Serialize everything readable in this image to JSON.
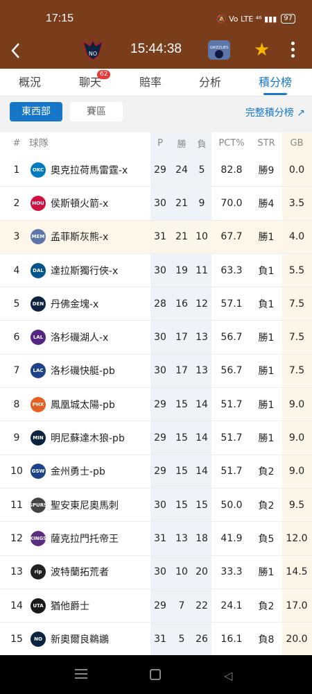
{
  "status_bar": {
    "time": "17:15",
    "icons": "🔕 Vo LTE ⁴⁶ ▮▮▮",
    "battery": "97"
  },
  "match": {
    "home_logo_text": "NO",
    "clock": "15:44:38",
    "away_logo_text": "GRIZZLIES",
    "home_color": "#0c2340",
    "away_color": "#5d76a9",
    "accent": "#f7b500"
  },
  "tabs": [
    {
      "label": "概況"
    },
    {
      "label": "聊天",
      "badge": "62"
    },
    {
      "label": "賠率"
    },
    {
      "label": "分析"
    },
    {
      "label": "積分榜"
    }
  ],
  "filter": {
    "segment_active": "東西部",
    "segment_inactive": "賽區",
    "full_standings": "完整積分榜 ↗"
  },
  "table": {
    "headers": {
      "rank": "#",
      "team": "球隊",
      "p": "P",
      "w": "勝",
      "l": "負",
      "pct": "PCT%",
      "str": "STR",
      "gb": "GB"
    },
    "rows": [
      {
        "rank": "1",
        "logo": "OKC",
        "color": "#007ac1",
        "team": "奧克拉荷馬雷霆-x",
        "p": "29",
        "w": "24",
        "l": "5",
        "pct": "82.8",
        "str": "勝9",
        "gb": "0.0"
      },
      {
        "rank": "2",
        "logo": "HOU",
        "color": "#ce1141",
        "team": "侯斯頓火箭-x",
        "p": "30",
        "w": "21",
        "l": "9",
        "pct": "70.0",
        "str": "勝4",
        "gb": "3.5"
      },
      {
        "rank": "3",
        "logo": "MEM",
        "color": "#5d76a9",
        "team": "孟菲斯灰熊-x",
        "p": "31",
        "w": "21",
        "l": "10",
        "pct": "67.7",
        "str": "勝1",
        "gb": "4.0",
        "highlight": true
      },
      {
        "rank": "4",
        "logo": "DAL",
        "color": "#00538c",
        "team": "達拉斯獨行俠-x",
        "p": "30",
        "w": "19",
        "l": "11",
        "pct": "63.3",
        "str": "負1",
        "gb": "5.5"
      },
      {
        "rank": "5",
        "logo": "DEN",
        "color": "#0e2240",
        "team": "丹佛金塊-x",
        "p": "28",
        "w": "16",
        "l": "12",
        "pct": "57.1",
        "str": "負1",
        "gb": "7.5"
      },
      {
        "rank": "6",
        "logo": "LAL",
        "color": "#552583",
        "team": "洛杉磯湖人-x",
        "p": "30",
        "w": "17",
        "l": "13",
        "pct": "56.7",
        "str": "勝1",
        "gb": "7.5"
      },
      {
        "rank": "7",
        "logo": "LAC",
        "color": "#1d428a",
        "team": "洛杉磯快艇-pb",
        "p": "30",
        "w": "17",
        "l": "13",
        "pct": "56.7",
        "str": "勝1",
        "gb": "7.5"
      },
      {
        "rank": "8",
        "logo": "PHX",
        "color": "#e56020",
        "team": "鳳凰城太陽-pb",
        "p": "29",
        "w": "15",
        "l": "14",
        "pct": "51.7",
        "str": "勝1",
        "gb": "9.0"
      },
      {
        "rank": "9",
        "logo": "MIN",
        "color": "#0c2340",
        "team": "明尼蘇達木狼-pb",
        "p": "29",
        "w": "15",
        "l": "14",
        "pct": "51.7",
        "str": "勝1",
        "gb": "9.0"
      },
      {
        "rank": "10",
        "logo": "GSW",
        "color": "#1d428a",
        "team": "金州勇士-pb",
        "p": "29",
        "w": "15",
        "l": "14",
        "pct": "51.7",
        "str": "負2",
        "gb": "9.0"
      },
      {
        "rank": "11",
        "logo": "SPURS",
        "color": "#444444",
        "team": "聖安東尼奧馬刺",
        "p": "30",
        "w": "15",
        "l": "15",
        "pct": "50.0",
        "str": "負2",
        "gb": "9.5"
      },
      {
        "rank": "12",
        "logo": "KINGS",
        "color": "#5a2d81",
        "team": "薩克拉門托帝王",
        "p": "31",
        "w": "13",
        "l": "18",
        "pct": "41.9",
        "str": "負5",
        "gb": "12.0"
      },
      {
        "rank": "13",
        "logo": "rip",
        "color": "#222222",
        "team": "波特蘭拓荒者",
        "p": "30",
        "w": "10",
        "l": "20",
        "pct": "33.3",
        "str": "勝1",
        "gb": "14.5"
      },
      {
        "rank": "14",
        "logo": "UTA",
        "color": "#1a1a1a",
        "team": "猶他爵士",
        "p": "29",
        "w": "7",
        "l": "22",
        "pct": "24.1",
        "str": "負2",
        "gb": "17.0"
      },
      {
        "rank": "15",
        "logo": "NO",
        "color": "#0c2340",
        "team": "新奧爾良鵜鶘",
        "p": "31",
        "w": "5",
        "l": "26",
        "pct": "16.1",
        "str": "負8",
        "gb": "20.0"
      }
    ]
  }
}
